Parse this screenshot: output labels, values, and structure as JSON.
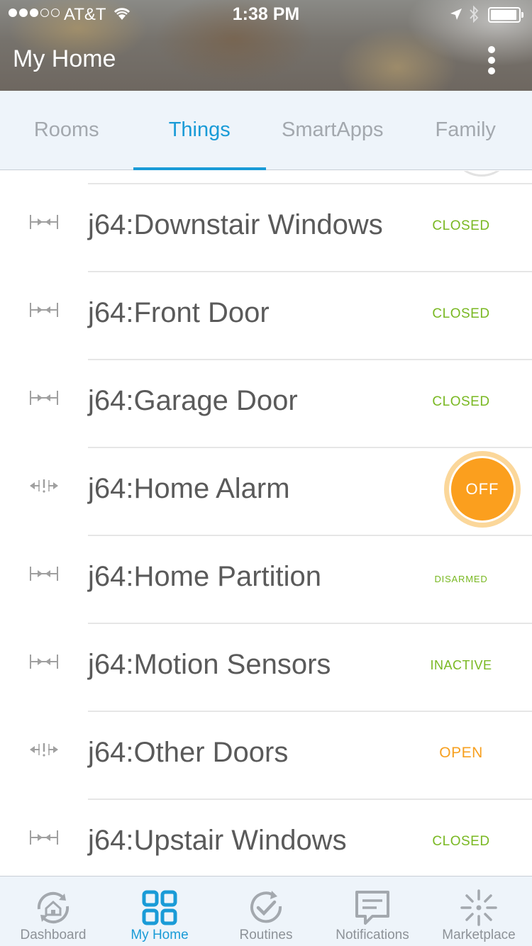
{
  "status_bar": {
    "carrier": "AT&T",
    "time": "1:38 PM",
    "signal_bars_filled": 3,
    "signal_bars_total": 5
  },
  "header": {
    "title": "My Home",
    "menu_icon": "more-vertical-icon"
  },
  "tabs": [
    {
      "label": "Rooms",
      "active": false
    },
    {
      "label": "Things",
      "active": true
    },
    {
      "label": "SmartApps",
      "active": false
    },
    {
      "label": "Family",
      "active": false
    }
  ],
  "things": [
    {
      "name": "j64:Downstair Windows",
      "status": "CLOSED",
      "icon": "arrows-inward-icon"
    },
    {
      "name": "j64:Front Door",
      "status": "CLOSED",
      "icon": "arrows-inward-icon"
    },
    {
      "name": "j64:Garage Door",
      "status": "CLOSED",
      "icon": "arrows-inward-icon"
    },
    {
      "name": "j64:Home Alarm",
      "status": "OFF",
      "icon": "arrows-outward-alert-icon"
    },
    {
      "name": "j64:Home Partition",
      "status": "DISARMED",
      "icon": "arrows-inward-icon"
    },
    {
      "name": "j64:Motion Sensors",
      "status": "INACTIVE",
      "icon": "arrows-inward-icon"
    },
    {
      "name": "j64:Other Doors",
      "status": "OPEN",
      "icon": "arrows-outward-alert-icon"
    },
    {
      "name": "j64:Upstair Windows",
      "status": "CLOSED",
      "icon": "arrows-inward-icon"
    }
  ],
  "colors": {
    "accent": "#1a9bd7",
    "status_green": "#79b822",
    "status_orange": "#f7a020",
    "alarm_button": "#fb9f1e"
  },
  "bottom_nav": [
    {
      "label": "Dashboard",
      "icon": "dashboard-home-icon",
      "active": false
    },
    {
      "label": "My Home",
      "icon": "grid-icon",
      "active": true
    },
    {
      "label": "Routines",
      "icon": "routine-check-icon",
      "active": false
    },
    {
      "label": "Notifications",
      "icon": "notifications-message-icon",
      "active": false
    },
    {
      "label": "Marketplace",
      "icon": "marketplace-burst-icon",
      "active": false
    }
  ]
}
